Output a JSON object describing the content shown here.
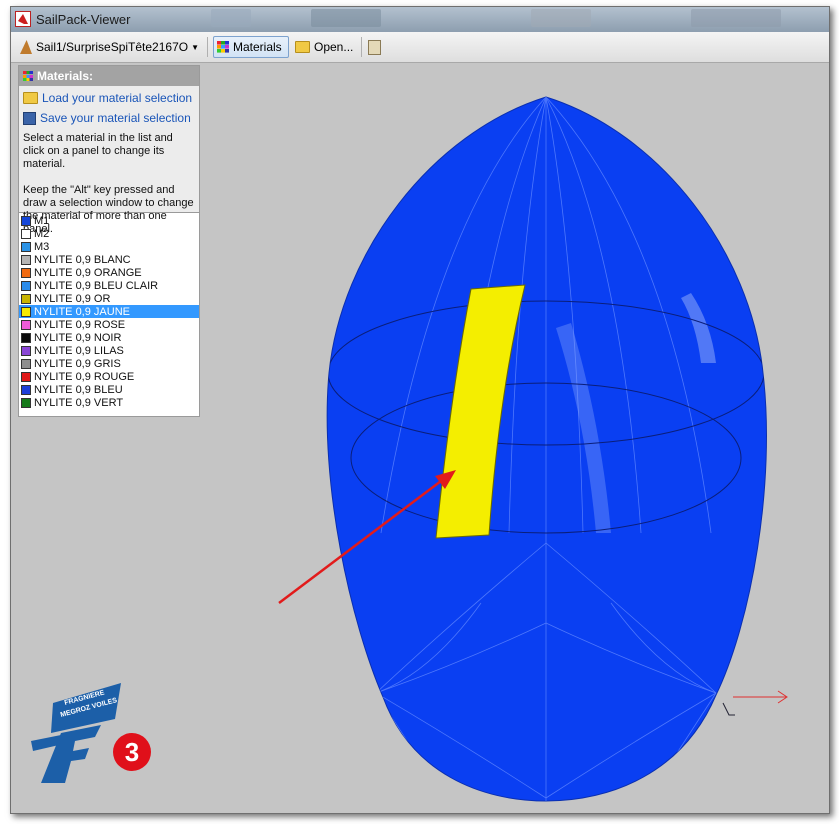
{
  "window": {
    "title": "SailPack-Viewer"
  },
  "toolbar": {
    "sail_file": "Sail1/SurpriseSpiTête2167O",
    "materials_label": "Materials",
    "open_label": "Open..."
  },
  "panel": {
    "title": "Materials:",
    "load_label": "Load your material selection",
    "save_label": "Save your material selection",
    "help": "Select a material in the list and click on a panel to change its material.\n\nKeep the \"Alt\" key pressed and draw a selection window to change the material of more than one panel.",
    "materials": [
      {
        "name": "M1",
        "color": "#1446d8"
      },
      {
        "name": "M2",
        "color": "#ffffff"
      },
      {
        "name": "M3",
        "color": "#2b93e6"
      },
      {
        "name": "NYLITE 0,9 BLANC",
        "color": "#b4b4b4"
      },
      {
        "name": "NYLITE 0,9 ORANGE",
        "color": "#f06a10"
      },
      {
        "name": "NYLITE 0,9 BLEU CLAIR",
        "color": "#2a8bea"
      },
      {
        "name": "NYLITE 0,9 OR",
        "color": "#c9b400"
      },
      {
        "name": "NYLITE 0,9 JAUNE",
        "color": "#f5ea00"
      },
      {
        "name": "NYLITE 0,9 ROSE",
        "color": "#ee5bd8"
      },
      {
        "name": "NYLITE 0,9 NOIR",
        "color": "#0a0a0a"
      },
      {
        "name": "NYLITE 0,9 LILAS",
        "color": "#8a46d6"
      },
      {
        "name": "NYLITE 0,9 GRIS",
        "color": "#8e8e8e"
      },
      {
        "name": "NYLITE 0,9 ROUGE",
        "color": "#e01818"
      },
      {
        "name": "NYLITE 0,9 BLEU",
        "color": "#1d3ed8"
      },
      {
        "name": "NYLITE 0,9 VERT",
        "color": "#157a1a"
      }
    ],
    "selected_index": 7
  },
  "sail": {
    "main_color": "#0a3ff2",
    "selected_panel_color": "#f4ee00"
  },
  "brand": {
    "line1": "FRAGNIERE",
    "line2": "MEGROZ VOILES",
    "mark": "F"
  },
  "step_badge": "3",
  "annotation": {
    "arrow_color": "#e21b1b"
  }
}
